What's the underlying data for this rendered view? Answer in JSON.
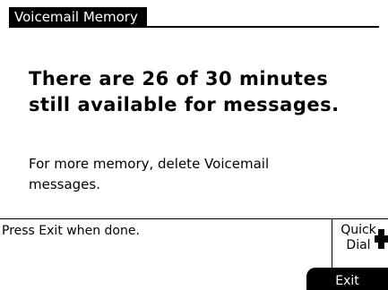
{
  "header": {
    "title": "Voicemail Memory"
  },
  "message": {
    "headline_lines": [
      "There are 26 of 30 minutes",
      "still available for messages."
    ],
    "note_lines": [
      "For more memory, delete Voicemail",
      "messages."
    ]
  },
  "footer": {
    "status": "Press Exit when done.",
    "quick_dial_lines": [
      "Quick",
      "Dial"
    ],
    "exit_label": "Exit"
  }
}
